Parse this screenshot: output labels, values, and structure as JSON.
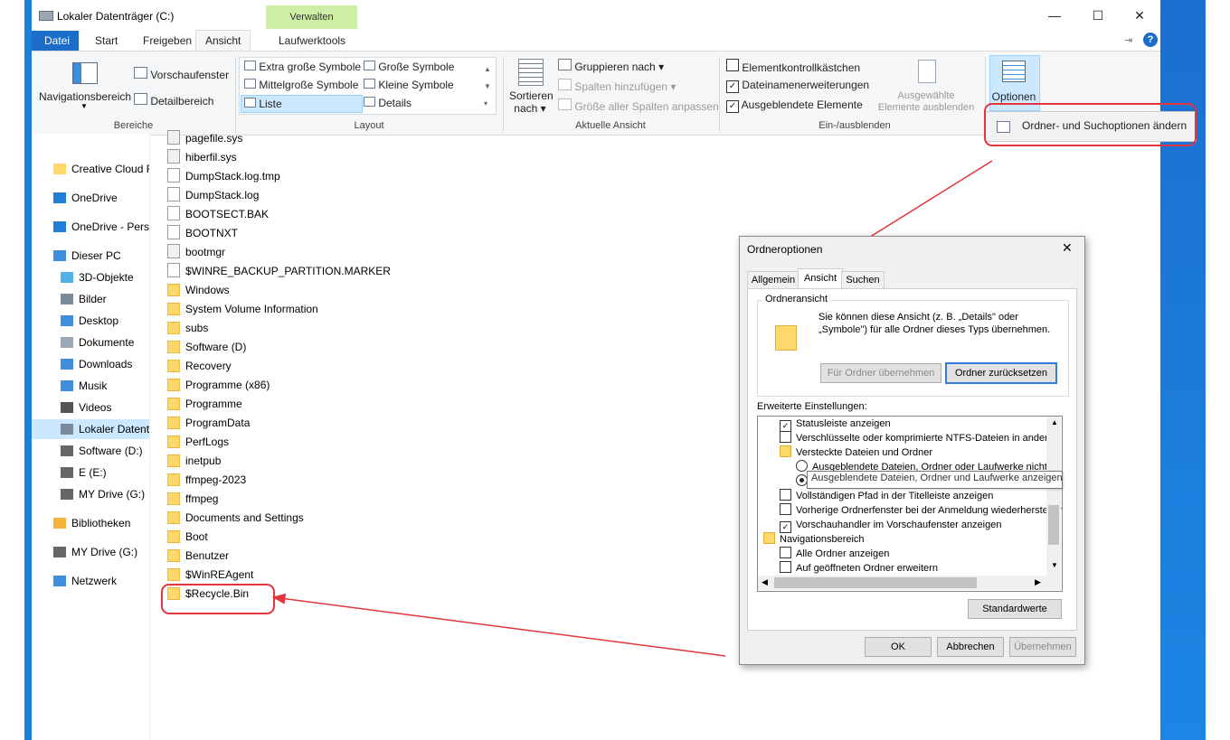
{
  "window": {
    "title": "Lokaler Datenträger (C:)",
    "context_tab": "Verwalten",
    "minimize": "—",
    "maximize": "☐",
    "close": "✕"
  },
  "tabs": [
    "Datei",
    "Start",
    "Freigeben",
    "Ansicht",
    "Laufwerktools"
  ],
  "ribbon": {
    "bereiche": {
      "label": "Bereiche",
      "nav": "Navigationsbereich",
      "preview": "Vorschaufenster",
      "detail": "Detailbereich"
    },
    "layout": {
      "label": "Layout",
      "items": [
        "Extra große Symbole",
        "Große Symbole",
        "Mittelgroße Symbole",
        "Kleine Symbole",
        "Liste",
        "Details"
      ]
    },
    "ansicht": {
      "label": "Aktuelle Ansicht",
      "sort": "Sortieren",
      "sort2": "nach",
      "group": "Gruppieren nach",
      "addcols": "Spalten hinzufügen",
      "fitcols": "Größe aller Spalten anpassen"
    },
    "einaus": {
      "label": "Ein-/ausblenden",
      "checkboxes": "Elementkontrollkästchen",
      "extensions": "Dateinamenerweiterungen",
      "hidden": "Ausgeblendete Elemente",
      "hide_sel": "Ausgewählte",
      "hide_sel2": "Elemente ausblenden"
    },
    "optionen": {
      "label": "Optionen",
      "menu_item": "Ordner- und Suchoptionen ändern"
    }
  },
  "nav": [
    "Creative Cloud F",
    "OneDrive",
    "OneDrive - Perso",
    "Dieser PC",
    "3D-Objekte",
    "Bilder",
    "Desktop",
    "Dokumente",
    "Downloads",
    "Musik",
    "Videos",
    "Lokaler Datent",
    "Software (D:)",
    "E (E:)",
    "MY Drive (G:)",
    "Bibliotheken",
    "MY Drive (G:)",
    "Netzwerk"
  ],
  "files": [
    {
      "name": "pagefile.sys",
      "type": "sys"
    },
    {
      "name": "hiberfil.sys",
      "type": "sys"
    },
    {
      "name": "DumpStack.log.tmp",
      "type": "file"
    },
    {
      "name": "DumpStack.log",
      "type": "file"
    },
    {
      "name": "BOOTSECT.BAK",
      "type": "file"
    },
    {
      "name": "BOOTNXT",
      "type": "file"
    },
    {
      "name": "bootmgr",
      "type": "sys"
    },
    {
      "name": "$WINRE_BACKUP_PARTITION.MARKER",
      "type": "file"
    },
    {
      "name": "Windows",
      "type": "folder"
    },
    {
      "name": "System Volume Information",
      "type": "folder"
    },
    {
      "name": "subs",
      "type": "folder"
    },
    {
      "name": "Software (D)",
      "type": "folder"
    },
    {
      "name": "Recovery",
      "type": "folder"
    },
    {
      "name": "Programme (x86)",
      "type": "folder"
    },
    {
      "name": "Programme",
      "type": "folder"
    },
    {
      "name": "ProgramData",
      "type": "folder"
    },
    {
      "name": "PerfLogs",
      "type": "folder"
    },
    {
      "name": "inetpub",
      "type": "folder"
    },
    {
      "name": "ffmpeg-2023",
      "type": "folder"
    },
    {
      "name": "ffmpeg",
      "type": "folder"
    },
    {
      "name": "Documents and Settings",
      "type": "link"
    },
    {
      "name": "Boot",
      "type": "folder"
    },
    {
      "name": "Benutzer",
      "type": "folder"
    },
    {
      "name": "$WinREAgent",
      "type": "folder"
    },
    {
      "name": "$Recycle.Bin",
      "type": "folder"
    }
  ],
  "dialog": {
    "title": "Ordneroptionen",
    "tabs": [
      "Allgemein",
      "Ansicht",
      "Suchen"
    ],
    "folder_view_label": "Ordneransicht",
    "folder_view_desc": "Sie können diese Ansicht (z. B. „Details\" oder „Symbole\") für alle Ordner dieses Typs übernehmen.",
    "apply_btn": "Für Ordner übernehmen",
    "reset_btn": "Ordner zurücksetzen",
    "advanced_label": "Erweiterte Einstellungen:",
    "settings": [
      {
        "text": "Statusleiste anzeigen",
        "kind": "check",
        "checked": true,
        "indent": 1
      },
      {
        "text": "Verschlüsselte oder komprimierte NTFS-Dateien in anderer",
        "kind": "check",
        "checked": false,
        "indent": 1
      },
      {
        "text": "Versteckte Dateien und Ordner",
        "kind": "folder",
        "checked": false,
        "indent": 1
      },
      {
        "text": "Ausgeblendete Dateien, Ordner oder Laufwerke nicht a",
        "kind": "radio",
        "checked": false,
        "indent": 2
      },
      {
        "text": "Ausgeblendete Dateien, Ordner und Laufwerke anzeigen",
        "kind": "radio",
        "checked": true,
        "indent": 2
      },
      {
        "text": "Vollständigen Pfad in der Titelleiste anzeigen",
        "kind": "check",
        "checked": false,
        "indent": 1
      },
      {
        "text": "Vorherige Ordnerfenster bei der Anmeldung wiederherstellen",
        "kind": "check",
        "checked": false,
        "indent": 1
      },
      {
        "text": "Vorschauhandler im Vorschaufenster anzeigen",
        "kind": "check",
        "checked": true,
        "indent": 1
      },
      {
        "text": "Navigationsbereich",
        "kind": "nav",
        "checked": false,
        "indent": 0
      },
      {
        "text": "Alle Ordner anzeigen",
        "kind": "check",
        "checked": false,
        "indent": 1
      },
      {
        "text": "Auf geöffneten Ordner erweitern",
        "kind": "check",
        "checked": false,
        "indent": 1
      }
    ],
    "defaults_btn": "Standardwerte",
    "ok": "OK",
    "cancel": "Abbrechen",
    "apply": "Übernehmen"
  },
  "colors": {
    "accent": "#1c6cc9",
    "highlight": "#e5343d",
    "context_tab": "#cfeea5"
  }
}
